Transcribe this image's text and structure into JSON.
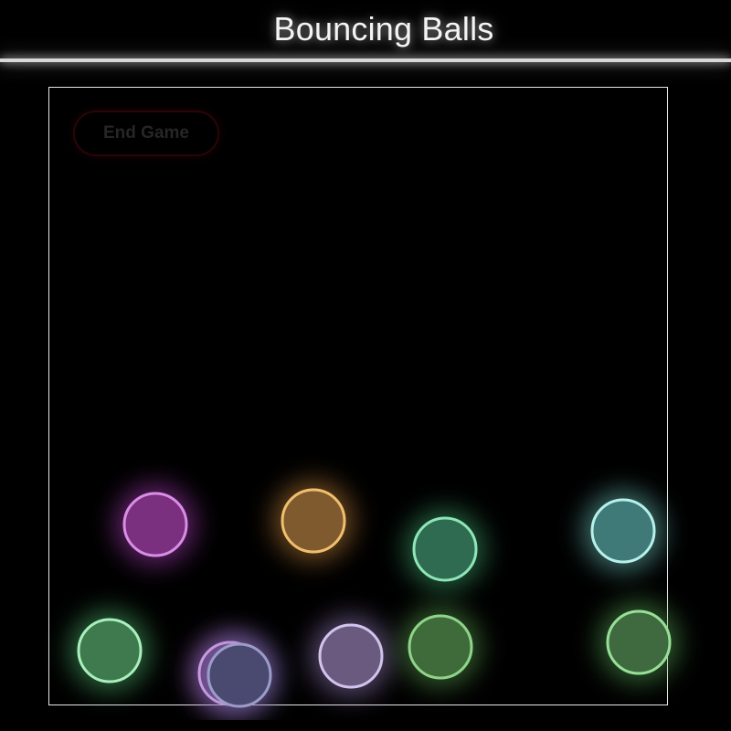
{
  "header": {
    "title": "Bouncing Balls"
  },
  "controls": {
    "end_game_label": "End Game"
  },
  "colors": {
    "background": "#000000",
    "title": "#f4f4f4",
    "arena_border": "#e8e8e8",
    "end_button_border": "#2a0508",
    "end_button_text": "#262626"
  },
  "balls": [
    {
      "name": "ball-purple",
      "fill": "#7a2f7f",
      "stroke": "#d98ee6",
      "glow": "#b040c0"
    },
    {
      "name": "ball-orange",
      "fill": "#7f5a2e",
      "stroke": "#f0bf6e",
      "glow": "#c8853a"
    },
    {
      "name": "ball-green-mid",
      "fill": "#2f6b50",
      "stroke": "#8fe6b8",
      "glow": "#3fa870"
    },
    {
      "name": "ball-teal",
      "fill": "#3f7a79",
      "stroke": "#b8f0ea",
      "glow": "#6ec8c0"
    },
    {
      "name": "ball-green-left",
      "fill": "#3f7a4f",
      "stroke": "#a8f0bc",
      "glow": "#50b870"
    },
    {
      "name": "ball-pink-back",
      "fill": "#6a3f7a",
      "stroke": "#e6a8f0",
      "glow": "#c070d8"
    },
    {
      "name": "ball-slate",
      "fill": "#4a4a70",
      "stroke": "#9c9cc8",
      "glow": "#7070b0"
    },
    {
      "name": "ball-lavender",
      "fill": "#6a5a80",
      "stroke": "#d2c4ec",
      "glow": "#9a80c0"
    },
    {
      "name": "ball-olive",
      "fill": "#3f6a3a",
      "stroke": "#8fd48a",
      "glow": "#5aa050"
    },
    {
      "name": "ball-green-right",
      "fill": "#3f6a3f",
      "stroke": "#98e098",
      "glow": "#58a858"
    }
  ]
}
